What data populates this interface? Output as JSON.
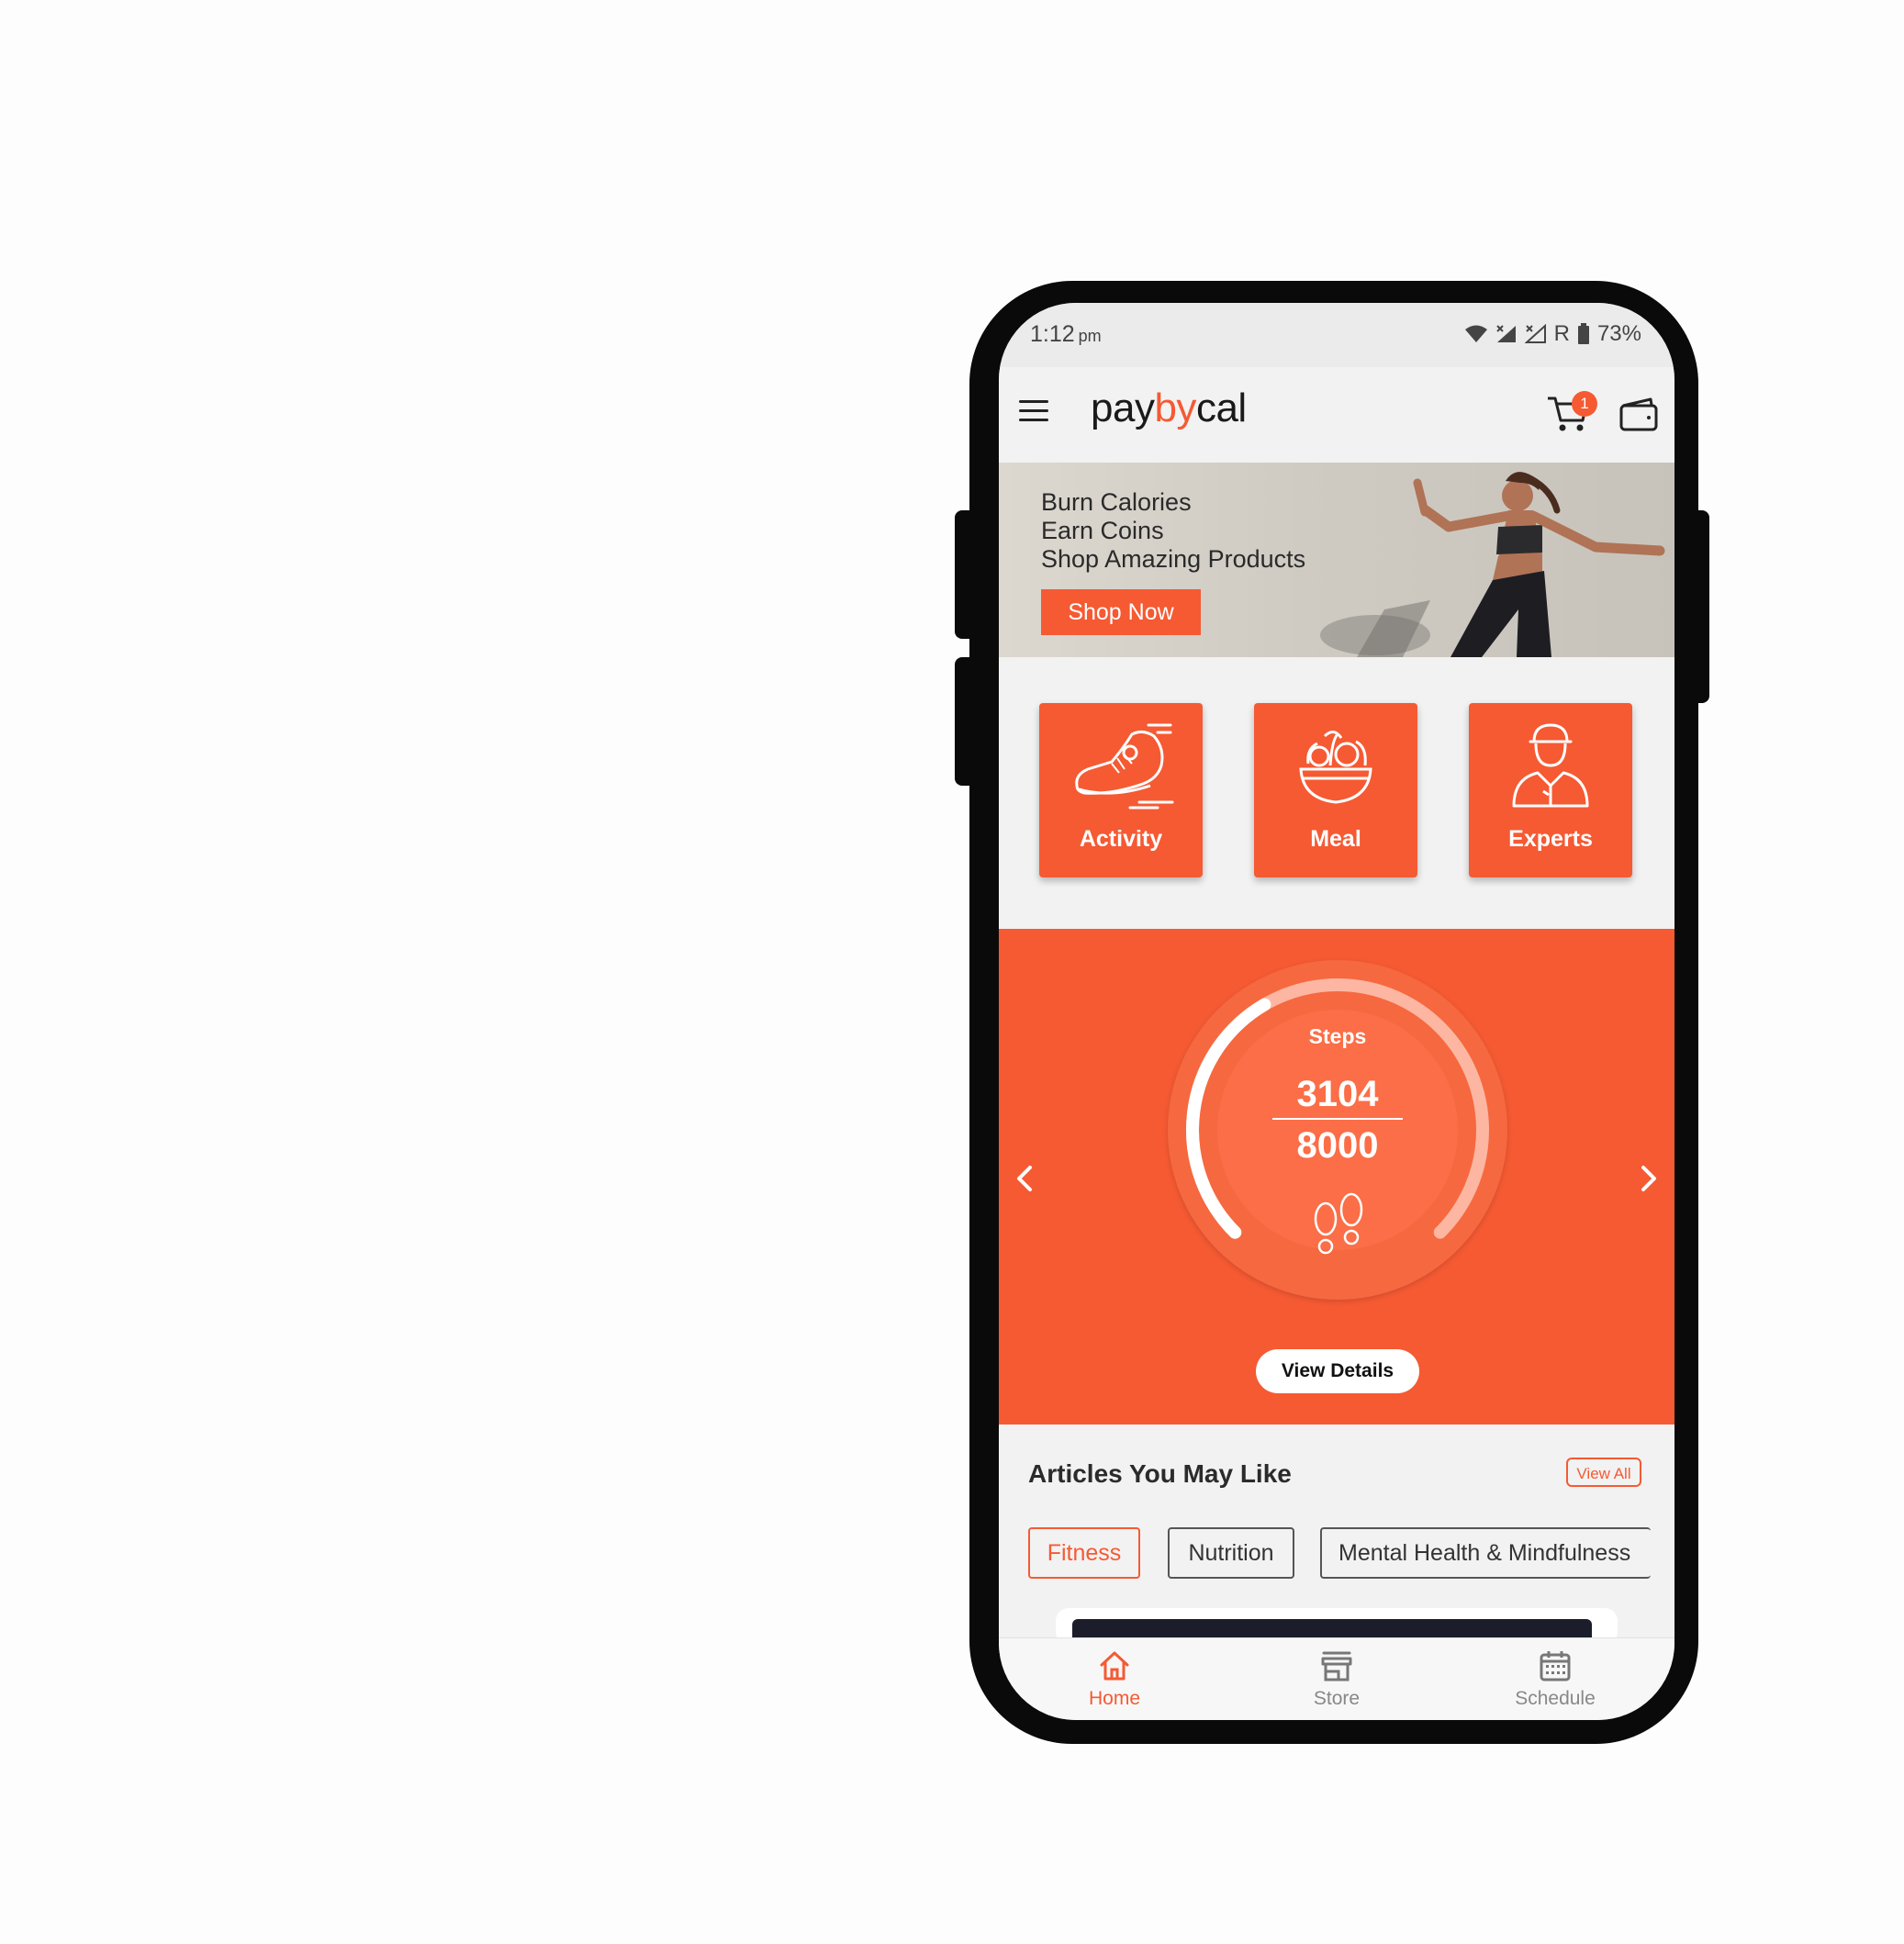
{
  "status_bar": {
    "time": "1:12",
    "ampm": "pm",
    "network_r": "R",
    "battery": "73%"
  },
  "app_bar": {
    "logo_pay": "pay",
    "logo_by": "by",
    "logo_cal": "cal",
    "cart_count": "1",
    "icons": [
      "menu-icon",
      "cart-icon",
      "wallet-icon"
    ]
  },
  "banner": {
    "line1": "Burn Calories",
    "line2": "Earn Coins",
    "line3": "Shop Amazing Products",
    "button": "Shop Now"
  },
  "tiles": [
    {
      "label": "Activity",
      "icon": "running-shoe-icon"
    },
    {
      "label": "Meal",
      "icon": "salad-bowl-icon"
    },
    {
      "label": "Experts",
      "icon": "expert-person-icon"
    }
  ],
  "steps_card": {
    "label": "Steps",
    "current": "3104",
    "goal": "8000",
    "progress": 0.388,
    "button": "View Details",
    "icons": [
      "chevron-left-icon",
      "chevron-right-icon",
      "footprints-icon"
    ]
  },
  "articles": {
    "title": "Articles You May Like",
    "view_all": "View All",
    "chips": [
      {
        "label": "Fitness",
        "active": true
      },
      {
        "label": "Nutrition",
        "active": false
      },
      {
        "label": "Mental Health & Mindfulness",
        "active": false
      }
    ]
  },
  "bottom_nav": [
    {
      "label": "Home",
      "icon": "home-icon",
      "active": true
    },
    {
      "label": "Store",
      "icon": "store-icon",
      "active": false
    },
    {
      "label": "Schedule",
      "icon": "calendar-icon",
      "active": false
    }
  ],
  "colors": {
    "accent": "#f55a33",
    "background": "#f2f2f2"
  }
}
